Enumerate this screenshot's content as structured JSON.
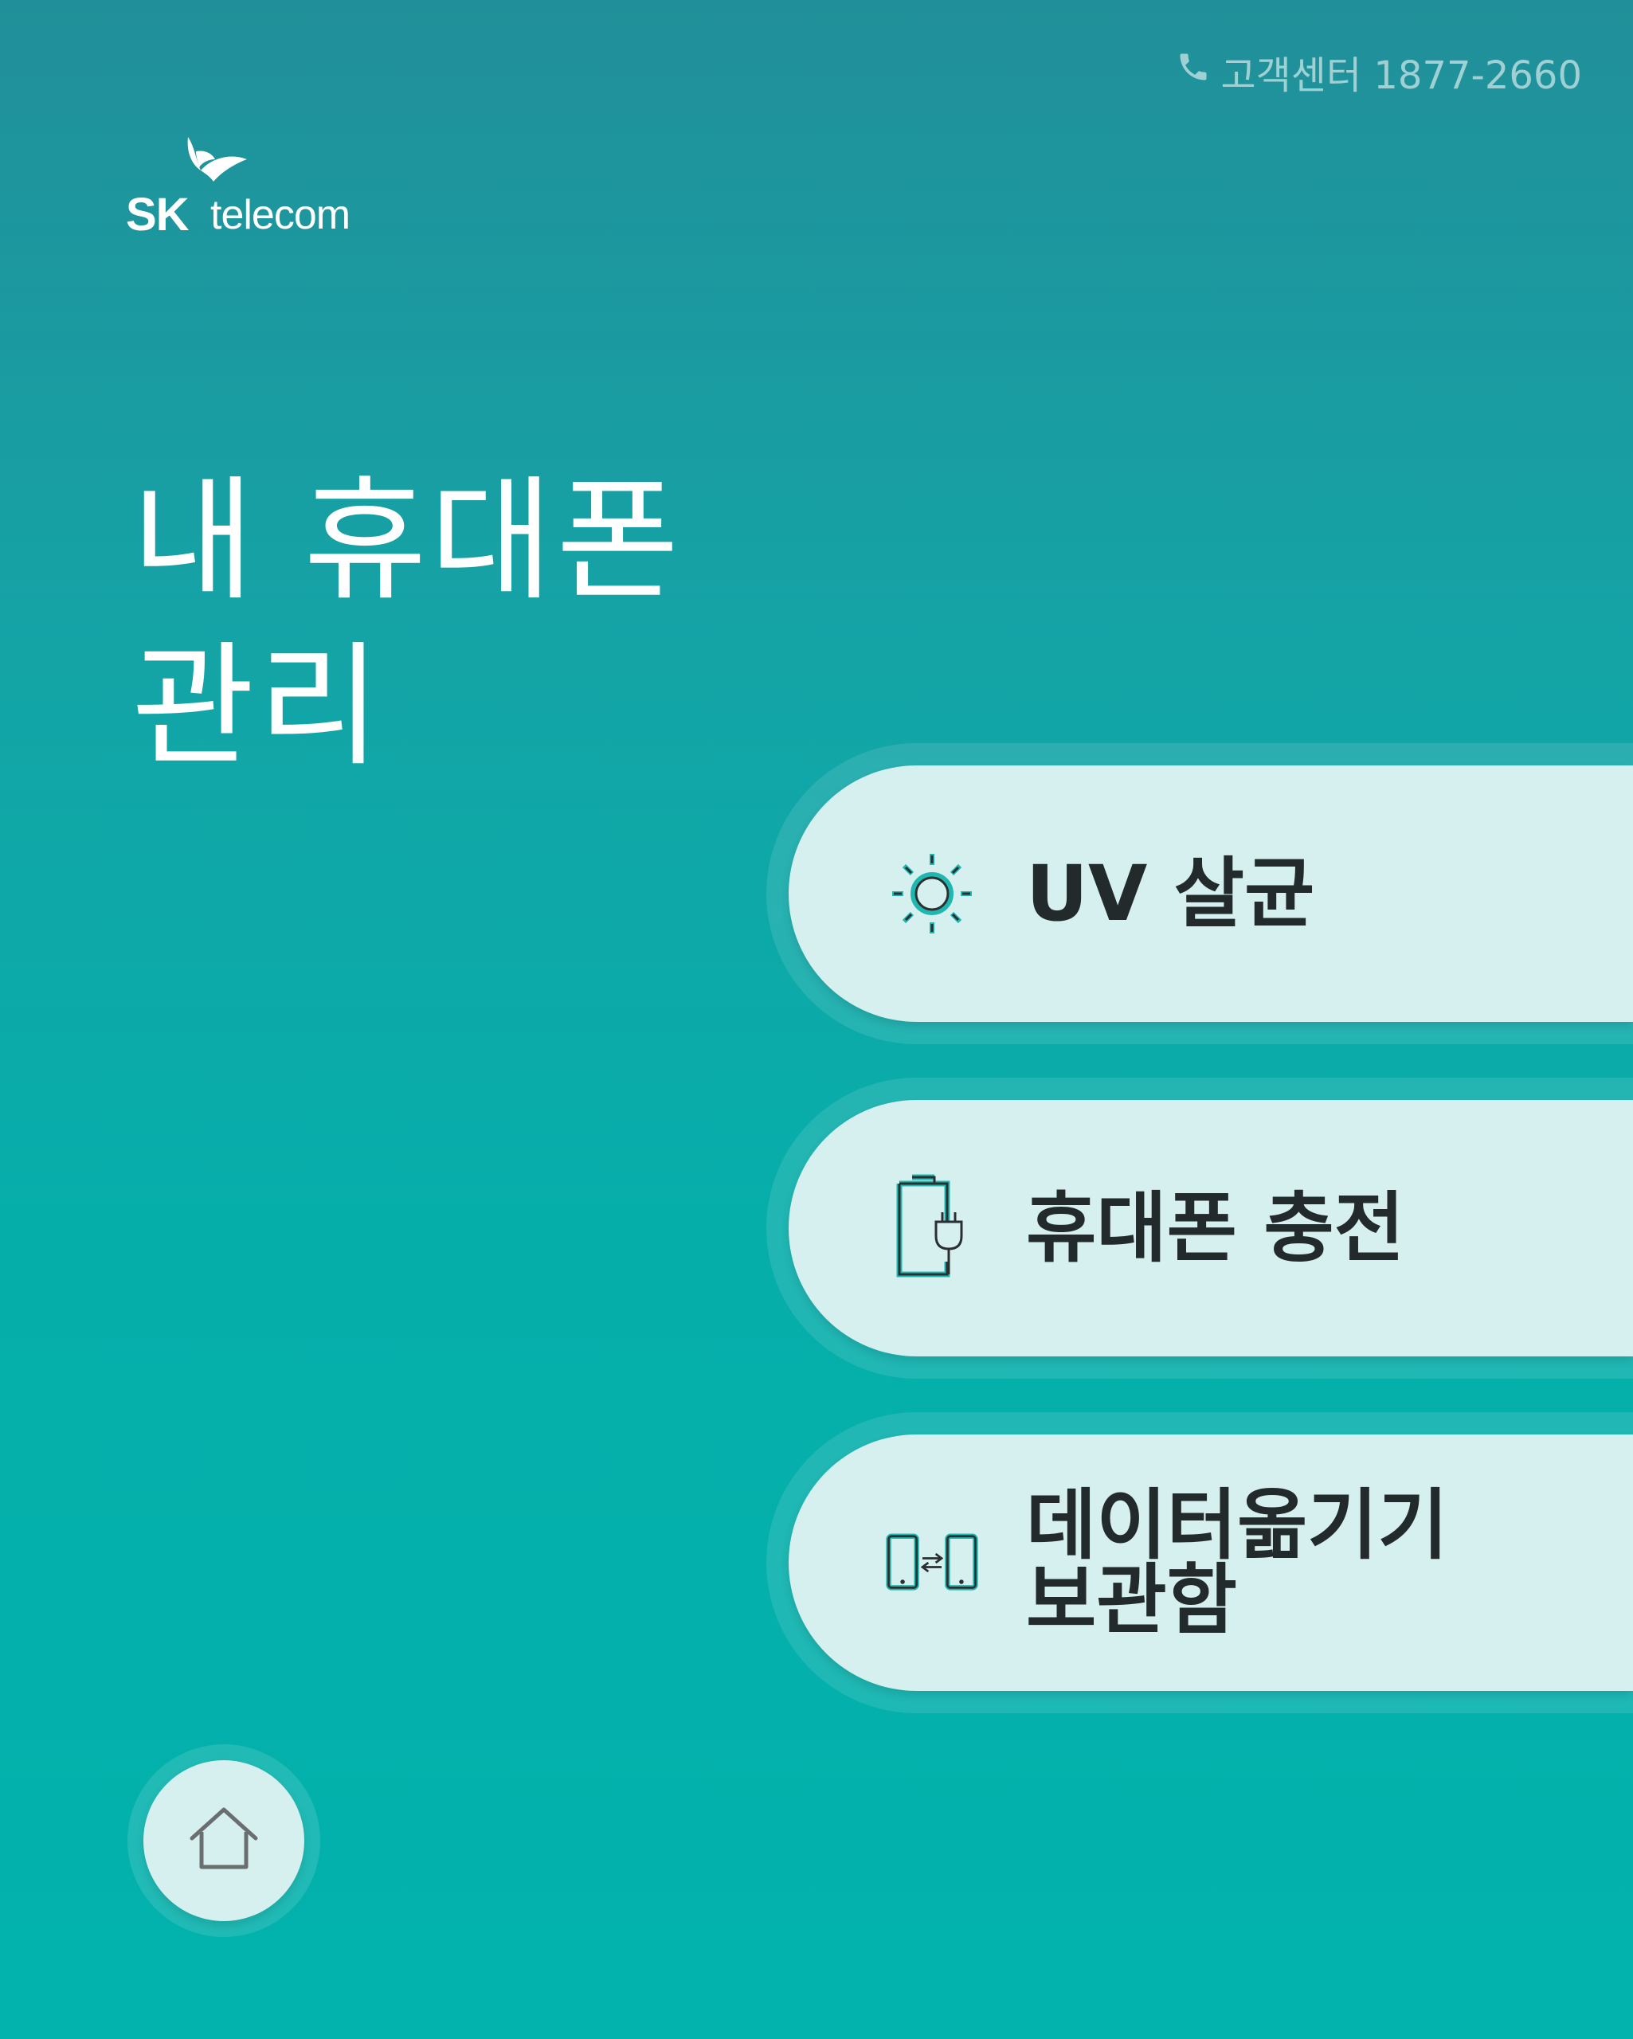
{
  "header": {
    "support_label": "고객센터 1877-2660",
    "support_icon": "phone-icon"
  },
  "logo": {
    "brand": "SK",
    "product": "telecom"
  },
  "page": {
    "title_line1": "내 휴대폰",
    "title_line2": "관리"
  },
  "menu": {
    "items": [
      {
        "id": "uv",
        "label": "UV 살균",
        "icon": "sun-icon"
      },
      {
        "id": "charge",
        "label": "휴대폰 충전",
        "icon": "battery-plug-icon"
      },
      {
        "id": "data",
        "label_line1": "데이터옮기기",
        "label_line2": "보관함",
        "icon": "phone-transfer-icon"
      }
    ]
  },
  "footer": {
    "home_icon": "home-icon"
  },
  "colors": {
    "background_top": "#218f99",
    "background_bottom": "#02b2ac",
    "pill": "#d5f0ee",
    "accent": "#1fb8b0",
    "text_dark": "#222a2c"
  }
}
